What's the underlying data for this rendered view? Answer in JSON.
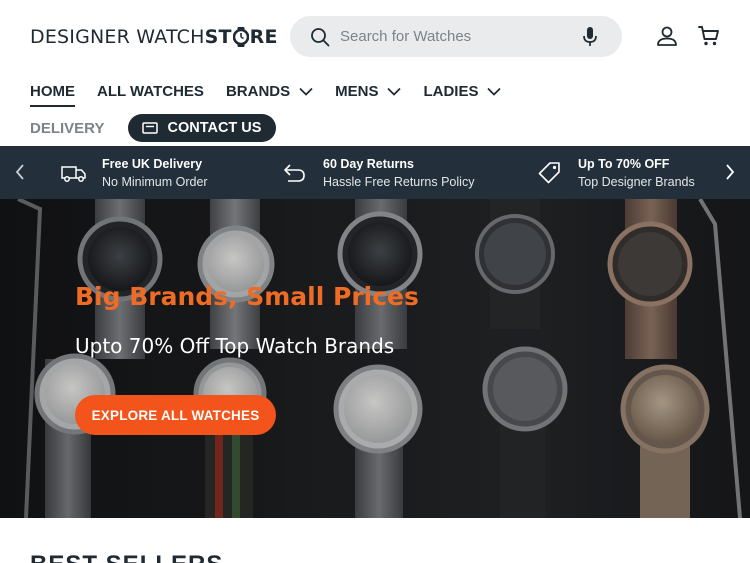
{
  "header": {
    "logo_light": "DESIGNER WATCH ST",
    "logo_bold_end": "RE",
    "logo_bold_start": "ST",
    "search_placeholder": "Search for Watches",
    "icons": {
      "search": "search-icon",
      "mic": "microphone-icon",
      "account": "account-icon",
      "cart": "cart-icon"
    }
  },
  "nav": {
    "items": [
      {
        "label": "HOME",
        "active": true,
        "dropdown": false
      },
      {
        "label": "ALL WATCHES",
        "active": false,
        "dropdown": false
      },
      {
        "label": "BRANDS",
        "active": false,
        "dropdown": true
      },
      {
        "label": "MENS",
        "active": false,
        "dropdown": true
      },
      {
        "label": "LADIES",
        "active": false,
        "dropdown": true
      }
    ],
    "delivery": "DELIVERY",
    "contact": "CONTACT US"
  },
  "promo": {
    "items": [
      {
        "title": "Free UK Delivery",
        "subtitle": "No Minimum Order",
        "icon": "truck-icon"
      },
      {
        "title": "60 Day Returns",
        "subtitle": "Hassle Free Returns Policy",
        "icon": "return-arrow-icon"
      },
      {
        "title": "Up To 70% OFF",
        "subtitle": "Top Designer Brands",
        "icon": "price-tag-icon"
      }
    ]
  },
  "hero": {
    "title": "Big Brands, Small Prices",
    "subtitle": "Upto 70% Off Top Watch Brands",
    "button": "EXPLORE ALL WATCHES"
  },
  "section": {
    "bestsellers": "BEST SELLERS"
  },
  "colors": {
    "brand_dark": "#1f2a33",
    "promo_bg": "#232f3a",
    "accent_orange": "#f2541b",
    "hero_title": "#f06c25"
  }
}
